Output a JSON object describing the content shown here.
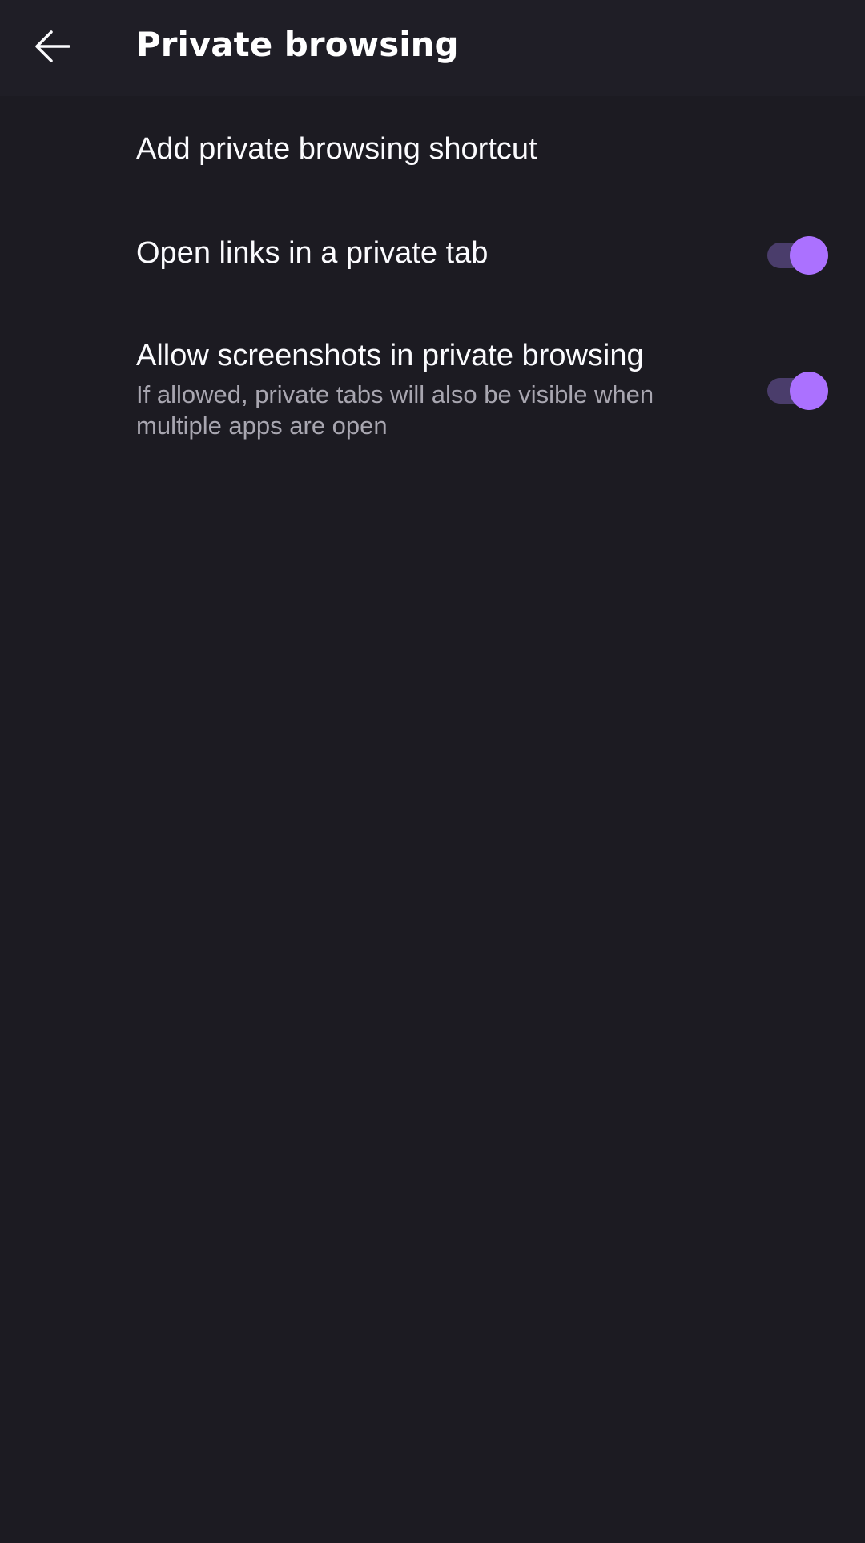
{
  "toolbar": {
    "back_icon": "arrow-left-icon",
    "title": "Private browsing"
  },
  "settings": {
    "items": [
      {
        "title": "Add private browsing shortcut"
      },
      {
        "title": "Open links in a private tab",
        "enabled": true
      },
      {
        "title": "Allow screenshots in private browsing",
        "summary": "If allowed, private tabs will also be visible when multiple apps are open",
        "enabled": true
      }
    ]
  },
  "colors": {
    "background": "#1c1b22",
    "toolbar": "#1f1e26",
    "switch_thumb": "#ab71ff",
    "switch_track": "#4a3d6b",
    "text_primary": "#fbfbfe",
    "text_secondary": "#a8a6b0"
  }
}
